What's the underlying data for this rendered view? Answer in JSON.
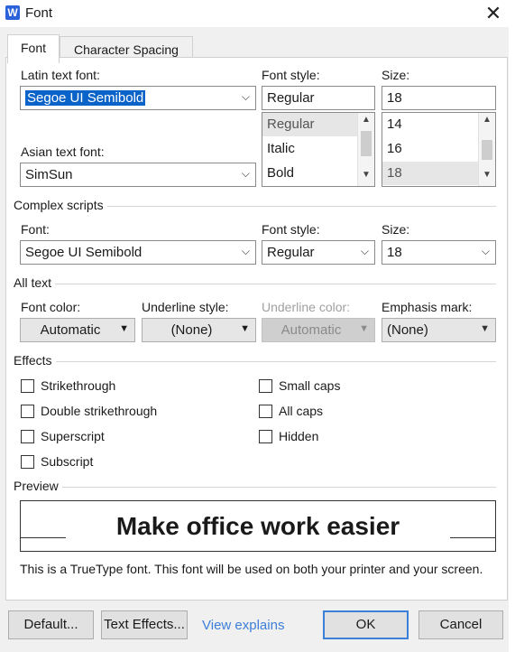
{
  "window": {
    "title": "Font",
    "app_icon_letter": "W"
  },
  "tabs": [
    {
      "label": "Font"
    },
    {
      "label": "Character Spacing"
    }
  ],
  "latin": {
    "font_label": "Latin text font:",
    "font_value": "Segoe UI Semibold",
    "style_label": "Font style:",
    "style_value": "Regular",
    "style_options": [
      "Regular",
      "Italic",
      "Bold"
    ],
    "size_label": "Size:",
    "size_value": "18",
    "size_options": [
      "14",
      "16",
      "18"
    ]
  },
  "asian": {
    "font_label": "Asian text font:",
    "font_value": "SimSun"
  },
  "complex": {
    "section_title": "Complex scripts",
    "font_label": "Font:",
    "font_value": "Segoe UI Semibold",
    "style_label": "Font style:",
    "style_value": "Regular",
    "size_label": "Size:",
    "size_value": "18"
  },
  "all_text": {
    "section_title": "All text",
    "color_label": "Font color:",
    "color_value": "Automatic",
    "underline_label": "Underline style:",
    "underline_value": "(None)",
    "underline_color_label": "Underline color:",
    "underline_color_value": "Automatic",
    "emphasis_label": "Emphasis mark:",
    "emphasis_value": "(None)"
  },
  "effects": {
    "section_title": "Effects",
    "left": [
      "Strikethrough",
      "Double strikethrough",
      "Superscript",
      "Subscript"
    ],
    "right": [
      "Small caps",
      "All caps",
      "Hidden"
    ]
  },
  "preview": {
    "section_title": "Preview",
    "sample": "Make office work easier",
    "note": "This is a TrueType font. This font will be used on both your printer and your screen."
  },
  "buttons": {
    "default": "Default...",
    "text_effects": "Text Effects...",
    "view_explains": "View explains",
    "ok": "OK",
    "cancel": "Cancel"
  }
}
